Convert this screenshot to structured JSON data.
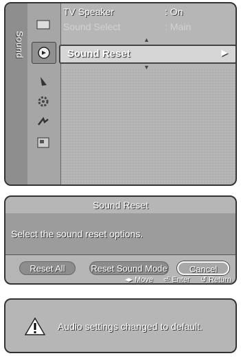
{
  "sound_menu": {
    "tab_label": "Sound",
    "items": [
      {
        "label": "TV Speaker",
        "value": ": On"
      },
      {
        "label": "Sound Select",
        "value": ": Main"
      },
      {
        "label": "Sound Reset",
        "value": ""
      }
    ],
    "selected_item": "Sound Reset",
    "left_icons": [
      "picture-icon",
      "sound-icon",
      "channel-icon",
      "setup-icon",
      "input-icon",
      "application-icon"
    ]
  },
  "reset_dialog": {
    "title": "Sound Reset",
    "message": "Select the sound reset options.",
    "buttons": [
      "Reset All",
      "Reset Sound Mode",
      "Cancel"
    ],
    "selected_button": "Cancel",
    "hints": {
      "move": "Move",
      "enter": "Enter",
      "return": "Return"
    }
  },
  "notification": {
    "message": "Audio settings changed to default."
  }
}
